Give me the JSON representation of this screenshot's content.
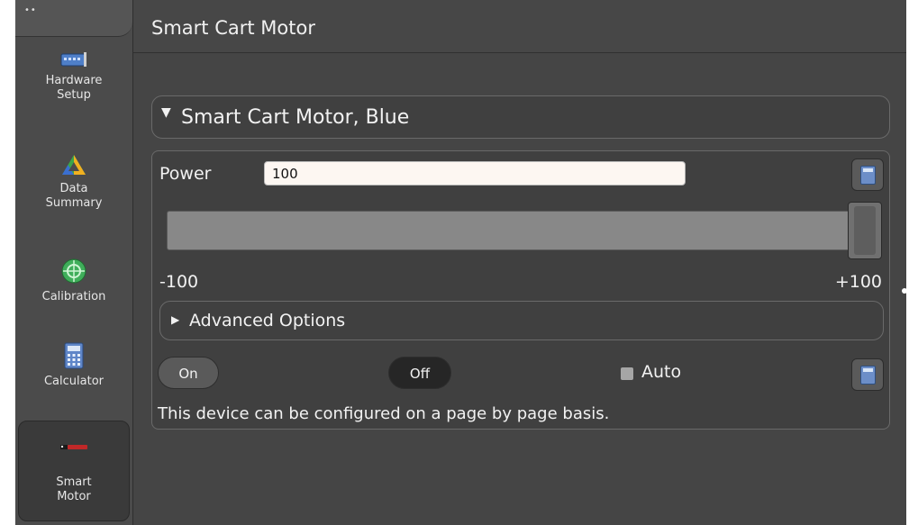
{
  "sidebar": {
    "top_dots": "••",
    "items": [
      {
        "label_line1": "Hardware",
        "label_line2": "Setup"
      },
      {
        "label_line1": "Data",
        "label_line2": "Summary"
      },
      {
        "label_line1": "Calibration",
        "label_line2": ""
      },
      {
        "label_line1": "Calculator",
        "label_line2": ""
      },
      {
        "label_line1": "Smart",
        "label_line2": "Motor"
      }
    ]
  },
  "header": {
    "title": "Smart Cart Motor"
  },
  "group": {
    "title": "Smart Cart Motor, Blue"
  },
  "power": {
    "label": "Power",
    "value": "100"
  },
  "slider": {
    "min_label": "-100",
    "max_label": "+100",
    "value": 100
  },
  "advanced": {
    "label": "Advanced Options"
  },
  "controls": {
    "on_label": "On",
    "off_label": "Off",
    "auto_label": "Auto"
  },
  "description": "This device can be configured on a page by page basis.",
  "colors": {
    "background": "#454545",
    "text": "#f2f2f2",
    "input_bg": "#fdf7f2"
  }
}
